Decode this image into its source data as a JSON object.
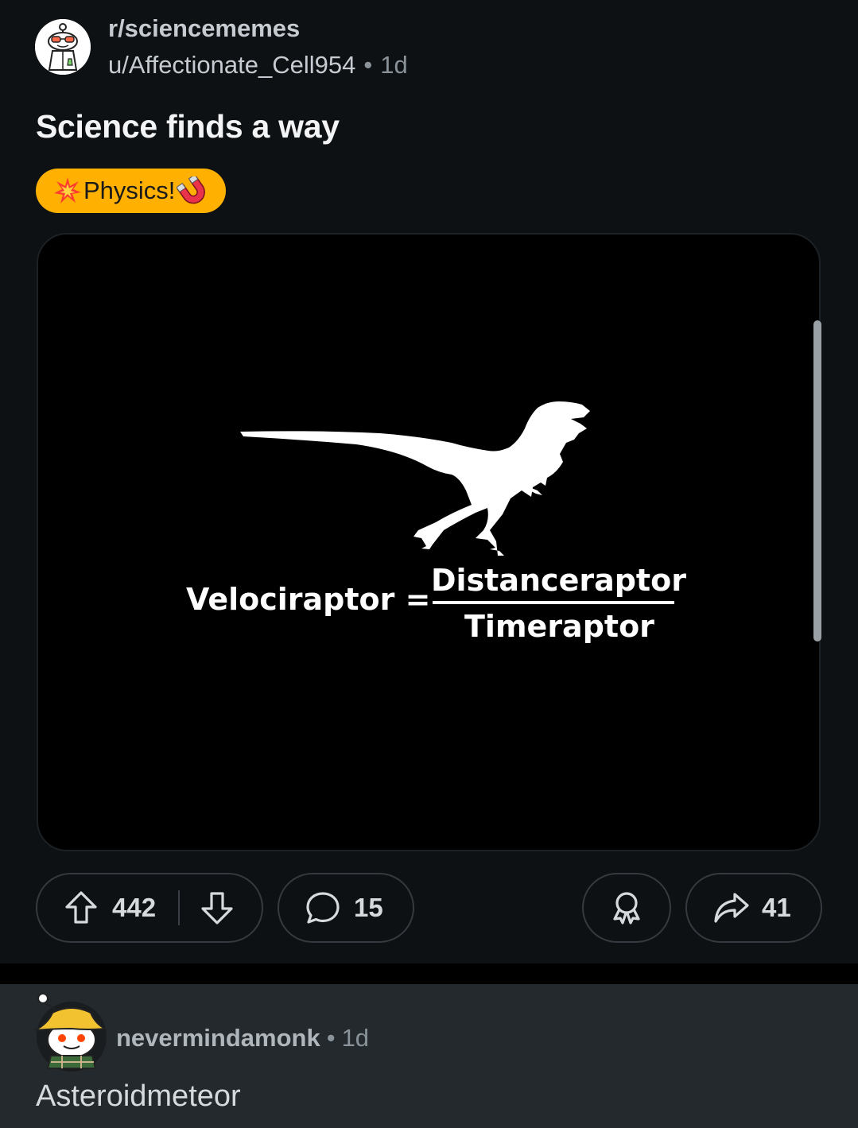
{
  "post": {
    "subreddit": "r/sciencememes",
    "author": "u/Affectionate_Cell954",
    "separator": "•",
    "age": "1d",
    "title": "Science finds a way",
    "flair": {
      "text": "Physics!",
      "color": "#ffb000",
      "icons": [
        "collision-icon",
        "magnet-icon"
      ]
    },
    "image": {
      "equation_left": "Velociraptor =",
      "numerator": "Distanceraptor",
      "denominator": "Timeraptor"
    },
    "actions": {
      "upvotes": "442",
      "comments": "15",
      "shares": "41"
    }
  },
  "comment": {
    "username": "nevermindamonk",
    "separator": "•",
    "age": "1d",
    "body": "Asteroidmeteor"
  },
  "colors": {
    "background": "#0e1113",
    "comment_background": "#23292d",
    "flair": "#ffb000"
  }
}
